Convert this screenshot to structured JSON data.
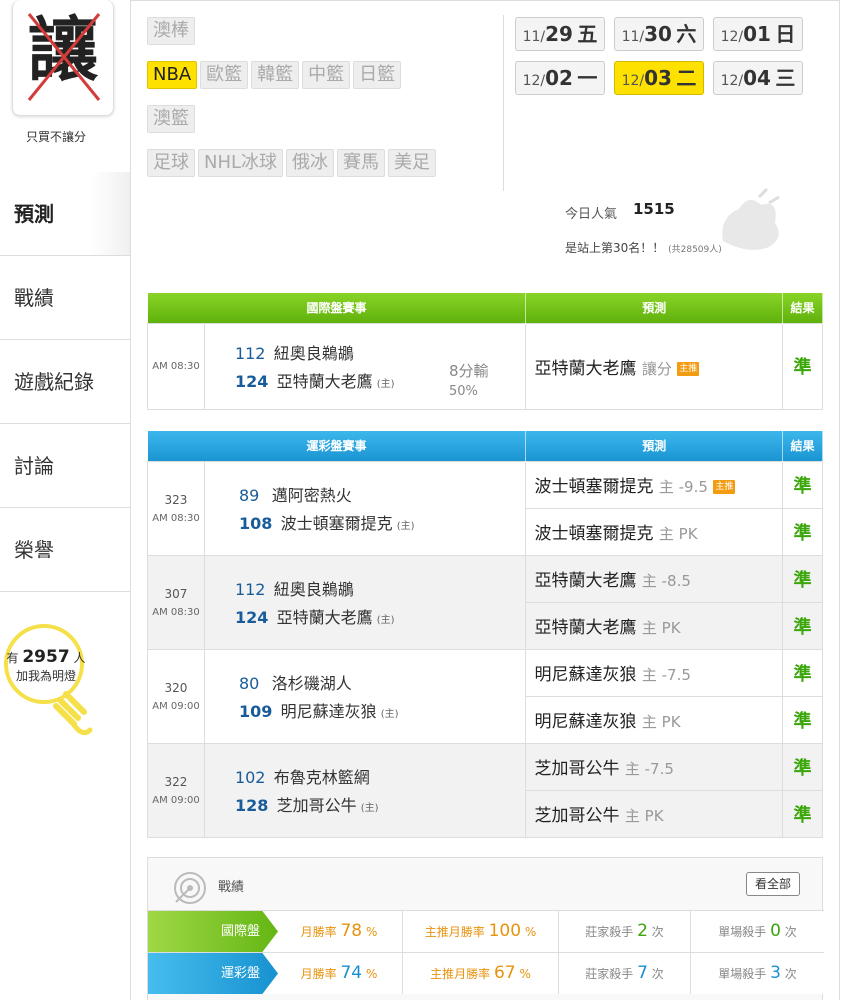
{
  "logo": {
    "char": "讓",
    "caption": "只買不讓分"
  },
  "nav": [
    {
      "label": "預測",
      "active": true
    },
    {
      "label": "戰績"
    },
    {
      "label": "遊戲紀錄"
    },
    {
      "label": "討論"
    },
    {
      "label": "榮譽"
    }
  ],
  "bulb": {
    "prefix": "有",
    "count": "2957",
    "suffix": "人",
    "line2": "加我為明燈"
  },
  "tags": {
    "row1": [
      "澳棒"
    ],
    "row2": [
      "NBA",
      "歐籃",
      "韓籃",
      "中籃",
      "日籃"
    ],
    "row3": [
      "澳籃"
    ],
    "row4": [
      "足球",
      "NHL冰球",
      "俄冰",
      "賽馬",
      "美足"
    ],
    "selected": "NBA"
  },
  "dates": [
    {
      "md": "11/",
      "d": "29",
      "w": "五"
    },
    {
      "md": "11/",
      "d": "30",
      "w": "六"
    },
    {
      "md": "12/",
      "d": "01",
      "w": "日"
    },
    {
      "md": "12/",
      "d": "02",
      "w": "一"
    },
    {
      "md": "12/",
      "d": "03",
      "w": "二",
      "on": true
    },
    {
      "md": "12/",
      "d": "04",
      "w": "三"
    }
  ],
  "popularity": {
    "label": "今日人氣",
    "value": "1515",
    "rank": "是站上第30名！！",
    "total": "(共28509人)"
  },
  "intl": {
    "headers": [
      "國際盤賽事",
      "預測",
      "結果"
    ],
    "row": {
      "time": "AM 08:30",
      "s1": "112",
      "t1": "紐奧良鵜鶘",
      "s2": "124",
      "t2": "亞特蘭大老鷹",
      "host": "(主)",
      "margin": "8分輸",
      "pct": "50%",
      "pred": "亞特蘭大老鷹",
      "pred_sub": "讓分",
      "badge": "主推",
      "res": "準"
    }
  },
  "lottery": {
    "headers": [
      "運彩盤賽事",
      "預測",
      "結果"
    ],
    "games": [
      {
        "code": "323",
        "time": "AM 08:30",
        "s1": "89",
        "t1": "邁阿密熱火",
        "s2": "108",
        "t2": "波士頓塞爾提克",
        "host": "(主)",
        "preds": [
          {
            "team": "波士頓塞爾提克",
            "sub": "主 -9.5",
            "badge": "主推",
            "res": "準"
          },
          {
            "team": "波士頓塞爾提克",
            "sub": "主 PK",
            "res": "準"
          }
        ]
      },
      {
        "code": "307",
        "time": "AM 08:30",
        "s1": "112",
        "t1": "紐奧良鵜鶘",
        "s2": "124",
        "t2": "亞特蘭大老鷹",
        "host": "(主)",
        "preds": [
          {
            "team": "亞特蘭大老鷹",
            "sub": "主 -8.5",
            "res": "準"
          },
          {
            "team": "亞特蘭大老鷹",
            "sub": "主 PK",
            "res": "準"
          }
        ]
      },
      {
        "code": "320",
        "time": "AM 09:00",
        "s1": "80",
        "t1": "洛杉磯湖人",
        "s2": "109",
        "t2": "明尼蘇達灰狼",
        "host": "(主)",
        "preds": [
          {
            "team": "明尼蘇達灰狼",
            "sub": "主 -7.5",
            "res": "準"
          },
          {
            "team": "明尼蘇達灰狼",
            "sub": "主 PK",
            "res": "準"
          }
        ]
      },
      {
        "code": "322",
        "time": "AM 09:00",
        "s1": "102",
        "t1": "布魯克林籃網",
        "s2": "128",
        "t2": "芝加哥公牛",
        "host": "(主)",
        "preds": [
          {
            "team": "芝加哥公牛",
            "sub": "主 -7.5",
            "res": "準"
          },
          {
            "team": "芝加哥公牛",
            "sub": "主 PK",
            "res": "準"
          }
        ]
      }
    ]
  },
  "record": {
    "title": "戰績",
    "view_all": "看全部",
    "rows": [
      {
        "label": "國際盤",
        "m_label": "月勝率",
        "m": "78",
        "mp": "%",
        "h_label": "主推月勝率",
        "h": "100",
        "hp": "%",
        "k_label": "莊家殺手",
        "k": "2",
        "ku": "次",
        "s_label": "單場殺手",
        "s": "0",
        "su": "次"
      },
      {
        "label": "運彩盤",
        "m_label": "月勝率",
        "m": "74",
        "mp": "%",
        "h_label": "主推月勝率",
        "h": "67",
        "hp": "%",
        "k_label": "莊家殺手",
        "k": "7",
        "ku": "次",
        "s_label": "單場殺手",
        "s": "3",
        "su": "次"
      }
    ]
  },
  "colors": {
    "accent_yellow": "#ffe100",
    "green": "#5fb10c",
    "blue": "#1b95d2",
    "win": "#3aa60a",
    "badge": "#f39c12"
  }
}
